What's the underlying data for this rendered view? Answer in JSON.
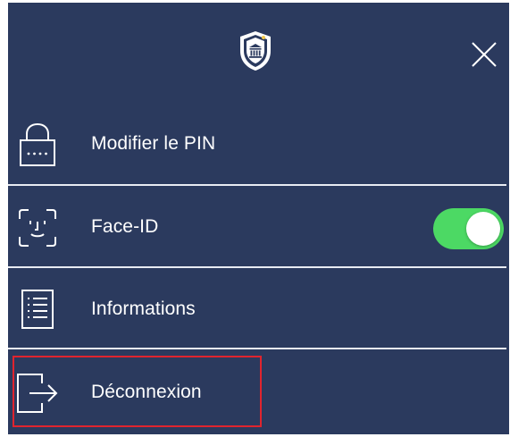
{
  "header": {
    "logo_icon": "bank-shield-logo",
    "close_icon": "close-x"
  },
  "menu": {
    "items": [
      {
        "label": "Modifier le PIN",
        "icon": "lock-pin-icon"
      },
      {
        "label": "Face-ID",
        "icon": "face-id-icon",
        "toggle": {
          "on": true
        }
      },
      {
        "label": "Informations",
        "icon": "document-list-icon"
      },
      {
        "label": "Déconnexion",
        "icon": "logout-icon"
      }
    ]
  },
  "colors": {
    "background": "#2b3a5e",
    "toggle_on": "#4cd964",
    "highlight": "#e0242e",
    "text": "#ffffff"
  }
}
